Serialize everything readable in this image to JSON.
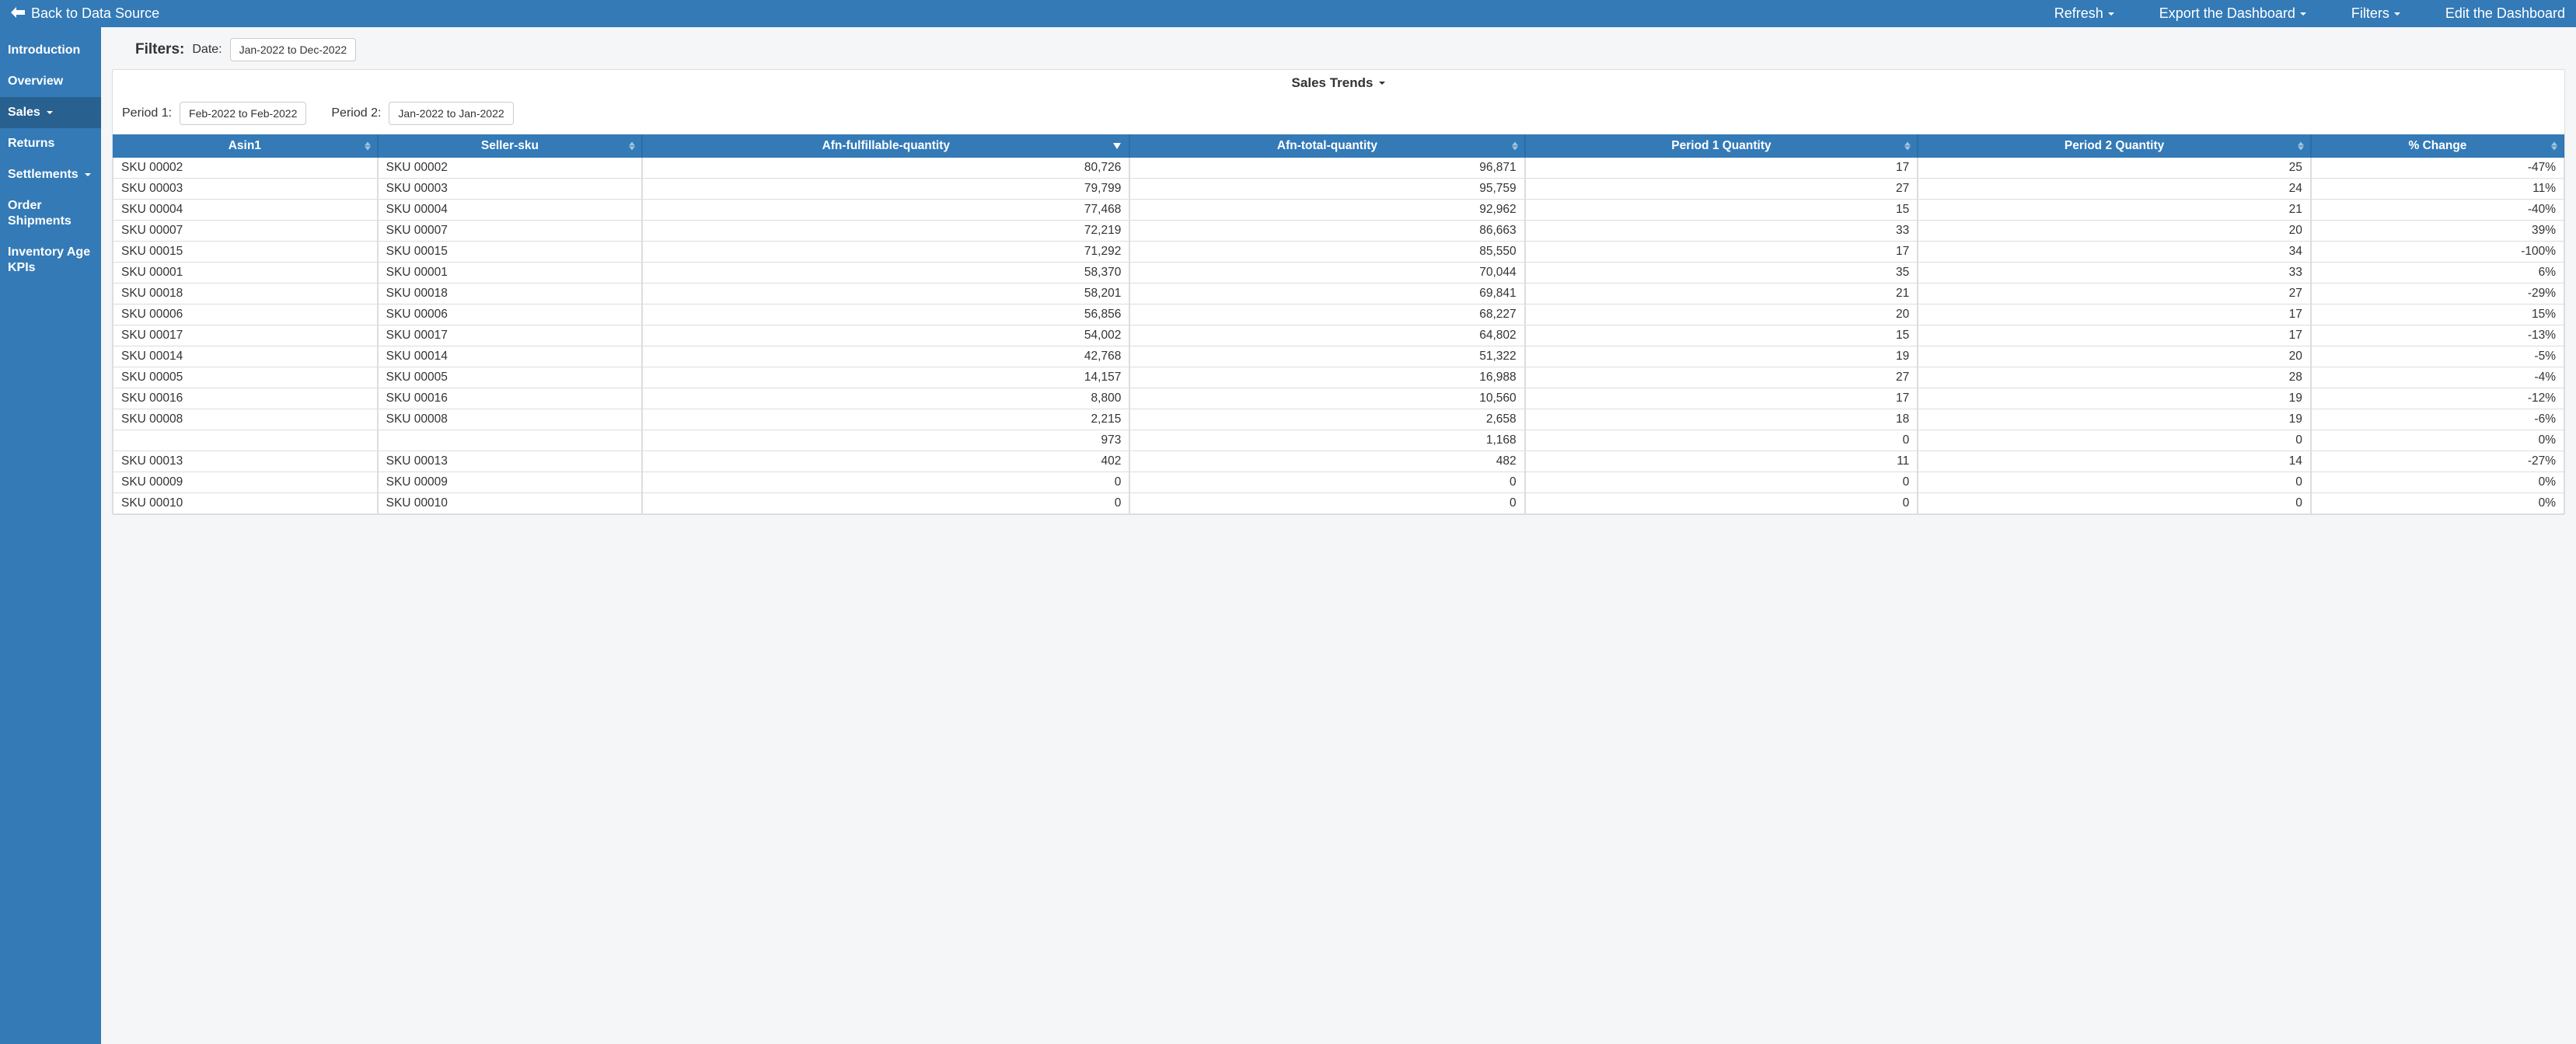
{
  "topbar": {
    "back_label": "Back to Data Source",
    "refresh": "Refresh",
    "export": "Export the Dashboard",
    "filters": "Filters",
    "edit": "Edit the Dashboard"
  },
  "sidebar": {
    "items": [
      {
        "label": "Introduction",
        "active": false,
        "has_caret": false
      },
      {
        "label": "Overview",
        "active": false,
        "has_caret": false
      },
      {
        "label": "Sales",
        "active": true,
        "has_caret": true
      },
      {
        "label": "Returns",
        "active": false,
        "has_caret": false
      },
      {
        "label": "Settlements",
        "active": false,
        "has_caret": true
      },
      {
        "label": "Order Shipments",
        "active": false,
        "has_caret": false
      },
      {
        "label": "Inventory Age KPIs",
        "active": false,
        "has_caret": false
      }
    ]
  },
  "filters_bar": {
    "label": "Filters:",
    "date_label": "Date:",
    "date_value": "Jan-2022 to Dec-2022"
  },
  "panel": {
    "title": "Sales Trends",
    "period1_label": "Period 1:",
    "period1_value": "Feb-2022 to Feb-2022",
    "period2_label": "Period 2:",
    "period2_value": "Jan-2022 to Jan-2022"
  },
  "table": {
    "columns": [
      {
        "label": "Asin1",
        "align": "txt",
        "sort": "dual"
      },
      {
        "label": "Seller-sku",
        "align": "txt",
        "sort": "dual"
      },
      {
        "label": "Afn-fulfillable-quantity",
        "align": "num",
        "sort": "desc"
      },
      {
        "label": "Afn-total-quantity",
        "align": "num",
        "sort": "dual"
      },
      {
        "label": "Period 1 Quantity",
        "align": "num",
        "sort": "dual"
      },
      {
        "label": "Period 2 Quantity",
        "align": "num",
        "sort": "dual"
      },
      {
        "label": "% Change",
        "align": "num",
        "sort": "dual"
      }
    ],
    "rows": [
      [
        "SKU 00002",
        "SKU 00002",
        "80,726",
        "96,871",
        "17",
        "25",
        "-47%"
      ],
      [
        "SKU 00003",
        "SKU 00003",
        "79,799",
        "95,759",
        "27",
        "24",
        "11%"
      ],
      [
        "SKU 00004",
        "SKU 00004",
        "77,468",
        "92,962",
        "15",
        "21",
        "-40%"
      ],
      [
        "SKU 00007",
        "SKU 00007",
        "72,219",
        "86,663",
        "33",
        "20",
        "39%"
      ],
      [
        "SKU 00015",
        "SKU 00015",
        "71,292",
        "85,550",
        "17",
        "34",
        "-100%"
      ],
      [
        "SKU 00001",
        "SKU 00001",
        "58,370",
        "70,044",
        "35",
        "33",
        "6%"
      ],
      [
        "SKU 00018",
        "SKU 00018",
        "58,201",
        "69,841",
        "21",
        "27",
        "-29%"
      ],
      [
        "SKU 00006",
        "SKU 00006",
        "56,856",
        "68,227",
        "20",
        "17",
        "15%"
      ],
      [
        "SKU 00017",
        "SKU 00017",
        "54,002",
        "64,802",
        "15",
        "17",
        "-13%"
      ],
      [
        "SKU 00014",
        "SKU 00014",
        "42,768",
        "51,322",
        "19",
        "20",
        "-5%"
      ],
      [
        "SKU 00005",
        "SKU 00005",
        "14,157",
        "16,988",
        "27",
        "28",
        "-4%"
      ],
      [
        "SKU 00016",
        "SKU 00016",
        "8,800",
        "10,560",
        "17",
        "19",
        "-12%"
      ],
      [
        "SKU 00008",
        "SKU 00008",
        "2,215",
        "2,658",
        "18",
        "19",
        "-6%"
      ],
      [
        "",
        "",
        "973",
        "1,168",
        "0",
        "0",
        "0%"
      ],
      [
        "SKU 00013",
        "SKU 00013",
        "402",
        "482",
        "11",
        "14",
        "-27%"
      ],
      [
        "SKU 00009",
        "SKU 00009",
        "0",
        "0",
        "0",
        "0",
        "0%"
      ],
      [
        "SKU 00010",
        "SKU 00010",
        "0",
        "0",
        "0",
        "0",
        "0%"
      ]
    ]
  }
}
